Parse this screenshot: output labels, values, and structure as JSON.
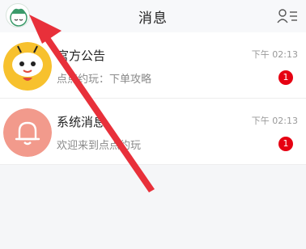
{
  "header": {
    "title": "消息",
    "avatar_icon": "cartoon-avatar-icon",
    "contacts_icon": "contacts-list-icon"
  },
  "messages": [
    {
      "name": "官方公告",
      "preview": "点点约玩：下单攻略",
      "time": "下午 02:13",
      "badge": "1",
      "icon": "mascot-avatar-icon"
    },
    {
      "name": "系统消息",
      "preview": "欢迎来到点点约玩",
      "time": "下午 02:13",
      "badge": "1",
      "icon": "bell-icon"
    }
  ],
  "colors": {
    "badge": "#e60012",
    "bell_bg": "#f29a8c",
    "annotation_arrow": "#e8303a"
  }
}
